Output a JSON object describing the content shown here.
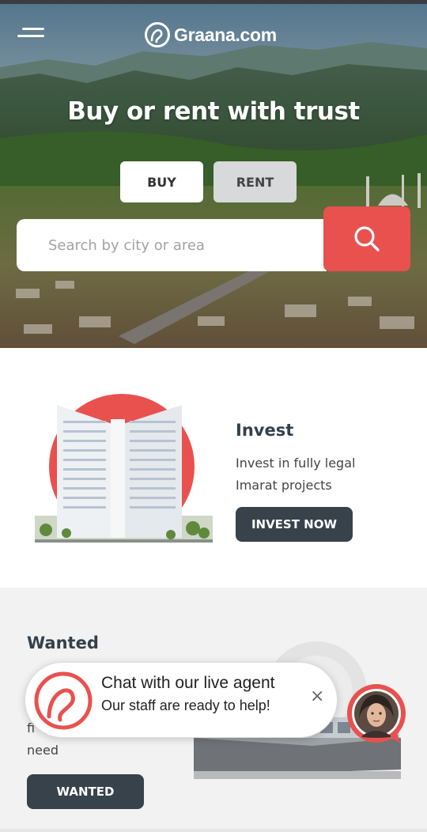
{
  "header": {
    "logo_text": "Graana.com",
    "menu_icon": "hamburger-menu-icon"
  },
  "hero": {
    "headline": "Buy or rent with trust",
    "tabs": [
      {
        "label": "BUY",
        "active": true
      },
      {
        "label": "RENT",
        "active": false
      }
    ],
    "search": {
      "placeholder": "Search by city or area",
      "value": "",
      "button_icon": "search-icon"
    }
  },
  "invest": {
    "title": "Invest",
    "description_line1": "Invest in fully legal",
    "description_line2": "Imarat projects",
    "button_label": "INVEST NOW"
  },
  "wanted": {
    "title": "Wanted",
    "description_line1": "fi",
    "description_line2": "need",
    "button_label": "WANTED"
  },
  "chat": {
    "title": "Chat with our live agent",
    "subtitle": "Our staff are ready to help!",
    "close_label": "×"
  },
  "colors": {
    "brand_red": "#e8514e",
    "dark_button": "#37424b",
    "heading": "#34404a"
  }
}
